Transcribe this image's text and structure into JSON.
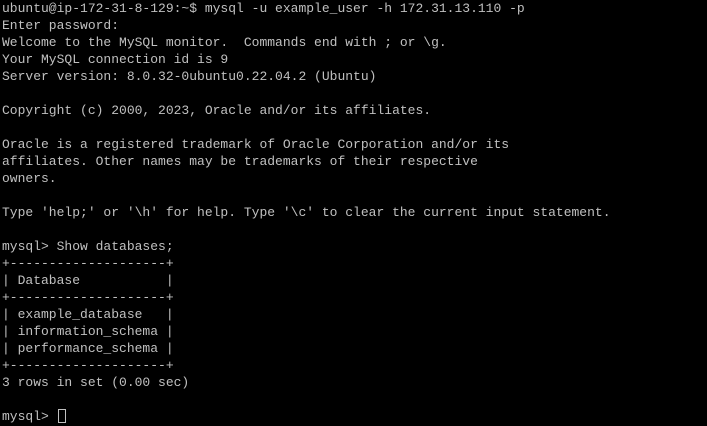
{
  "terminal": {
    "foreground": "#c0c0c0",
    "background": "#000000",
    "lines": [
      "ubuntu@ip-172-31-8-129:~$ mysql -u example_user -h 172.31.13.110 -p",
      "Enter password:",
      "Welcome to the MySQL monitor.  Commands end with ; or \\g.",
      "Your MySQL connection id is 9",
      "Server version: 8.0.32-0ubuntu0.22.04.2 (Ubuntu)",
      "",
      "Copyright (c) 2000, 2023, Oracle and/or its affiliates.",
      "",
      "Oracle is a registered trademark of Oracle Corporation and/or its",
      "affiliates. Other names may be trademarks of their respective",
      "owners.",
      "",
      "Type 'help;' or '\\h' for help. Type '\\c' to clear the current input statement.",
      "",
      "mysql> Show databases;",
      "+--------------------+",
      "| Database           |",
      "+--------------------+",
      "| example_database   |",
      "| information_schema |",
      "| performance_schema |",
      "+--------------------+",
      "3 rows in set (0.00 sec)",
      ""
    ],
    "prompt": "mysql> "
  }
}
